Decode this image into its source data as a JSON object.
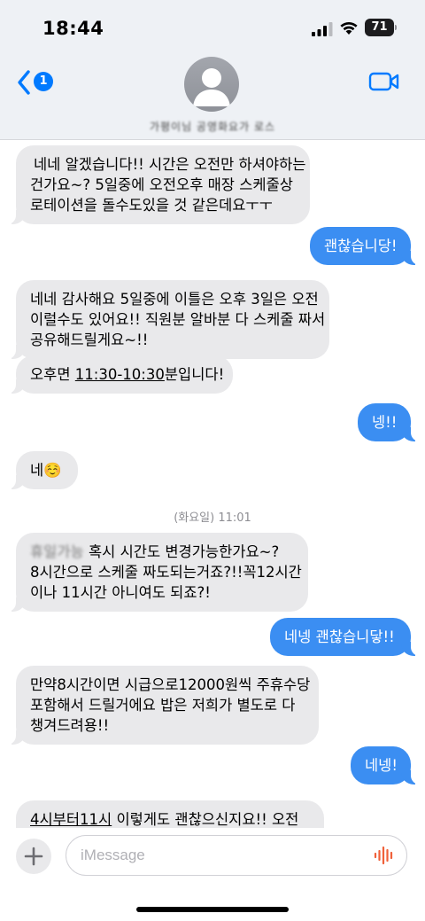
{
  "status_bar": {
    "time": "18:44",
    "battery": "71"
  },
  "header": {
    "back_badge": "1",
    "contact_name": "가평이님 공영화요가 로스"
  },
  "messages": [
    {
      "direction": "incoming",
      "lines": [
        "네네 알겠습니다!! 시간은 오전만 하셔야하는",
        "건가요~? 5일중에 오전오후 매장 스케줄상",
        "로테이션을 돌수도있을 것 같은데요ㅜㅜ"
      ]
    },
    {
      "direction": "outgoing",
      "lines": [
        "괜찮습니당!"
      ]
    },
    {
      "direction": "incoming",
      "lines": [
        "네네 감사해요 5일중에 이틀은 오후 3일은 오전",
        "이럴수도 있어요!! 직원분 알바분 다 스케줄 짜서",
        "공유해드릴게요~!!"
      ]
    },
    {
      "direction": "incoming",
      "prefix": "오후면 ",
      "link": "11:30-10:30",
      "suffix": "분입니다!"
    },
    {
      "direction": "outgoing",
      "lines": [
        "넹!!"
      ]
    },
    {
      "direction": "incoming",
      "lines": [
        "네☺️"
      ]
    },
    {
      "direction": "incoming",
      "blurred_prefix": "휴일가능",
      "lines": [
        "혹시 시간도 변경가능한가요~?",
        "8시간으로 스케줄 짜도되는거죠?!!꼭12시간",
        "이나 11시간 아니여도 되죠?!"
      ]
    },
    {
      "direction": "outgoing",
      "lines": [
        "네넹 괜찮습니닿!!"
      ]
    },
    {
      "direction": "incoming",
      "lines": [
        "만약8시간이면 시급으로12000원씩 주휴수당",
        "포함해서 드릴거에요 밥은 저희가 별도로 다",
        "챙겨드려용!!"
      ]
    },
    {
      "direction": "outgoing",
      "lines": [
        "네넹!"
      ]
    },
    {
      "direction": "incoming",
      "link": "4시부터11시",
      "suffix": " 이렇게도 괜찮으신지요!! 오전"
    }
  ],
  "timestamp": "(화요일) 11:01",
  "composer": {
    "placeholder": "iMessage",
    "value": ""
  },
  "colors": {
    "outgoing": "#3b8ef2",
    "incoming": "#e9e9eb",
    "accent": "#007aff",
    "mic": "#f0613a"
  }
}
